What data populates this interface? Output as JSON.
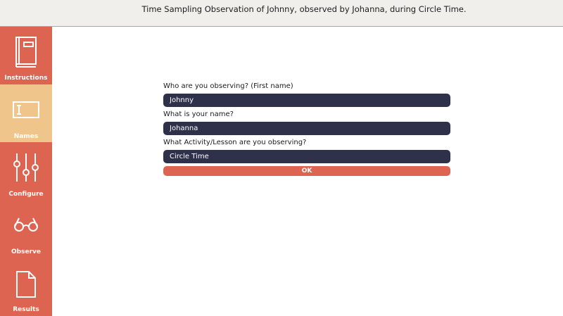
{
  "header": {
    "title": "Time Sampling Observation of Johnny, observed by Johanna, during Circle Time."
  },
  "sidebar": {
    "items": [
      {
        "label": "Instructions",
        "icon": "book-icon",
        "active": false
      },
      {
        "label": "Names",
        "icon": "text-field-icon",
        "active": true
      },
      {
        "label": "Configure",
        "icon": "sliders-icon",
        "active": false
      },
      {
        "label": "Observe",
        "icon": "glasses-icon",
        "active": false
      },
      {
        "label": "Results",
        "icon": "document-icon",
        "active": false
      }
    ]
  },
  "form": {
    "questions": [
      {
        "label": "Who are you observing? (First name)",
        "value": "Johnny"
      },
      {
        "label": "What is your name?",
        "value": "Johanna"
      },
      {
        "label": "What Activity/Lesson are you observing?",
        "value": "Circle Time"
      }
    ],
    "ok_label": "OK"
  },
  "colors": {
    "sidebar": "#dd6450",
    "sidebar_active": "#f0c58c",
    "input_bg": "#2f3049",
    "button": "#dd6450",
    "header_bg": "#f0efeb"
  }
}
